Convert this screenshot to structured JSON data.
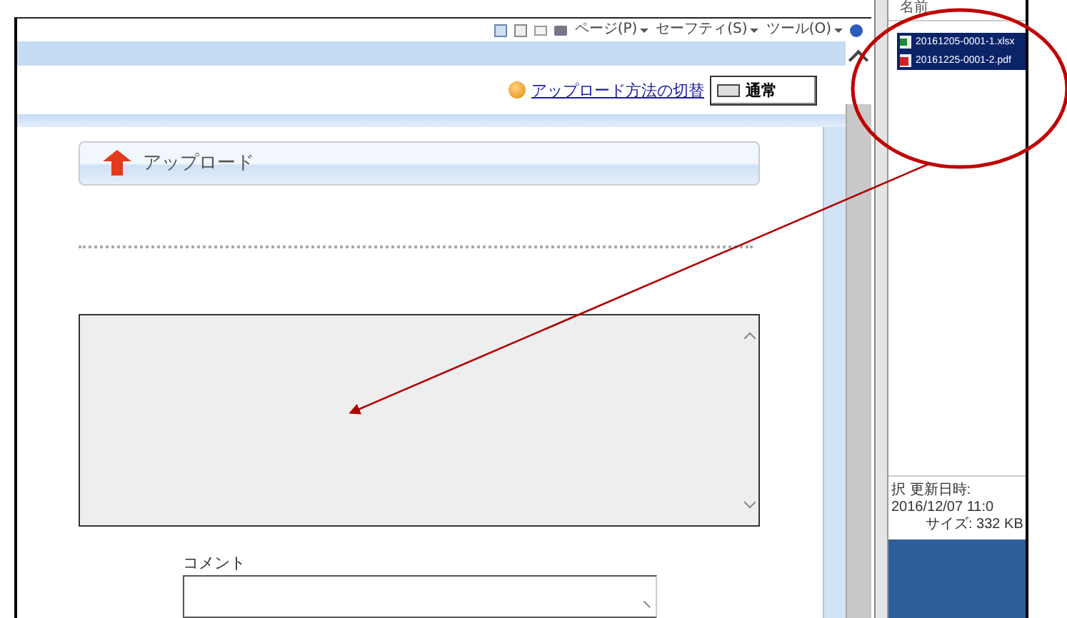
{
  "browser": {
    "toolbar_menus": [
      {
        "label": "ページ(P)"
      },
      {
        "label": "セーフティ(S)"
      },
      {
        "label": "ツール(O)"
      }
    ],
    "header": {
      "switch_link": "アップロード方法の切替",
      "mode_button": "通常"
    },
    "section_title": "アップロード",
    "comment_label": "コメント"
  },
  "explorer": {
    "column_header": "名前",
    "files": [
      {
        "name": "20161205-0001-1.xlsx",
        "kind": "excel",
        "selected": true
      },
      {
        "name": "20161225-0001-2.pdf",
        "kind": "pdf",
        "selected": true
      }
    ],
    "details": [
      "択 更新日時: 2016/12/07 11:0",
      "サイズ: 332 KB"
    ]
  }
}
